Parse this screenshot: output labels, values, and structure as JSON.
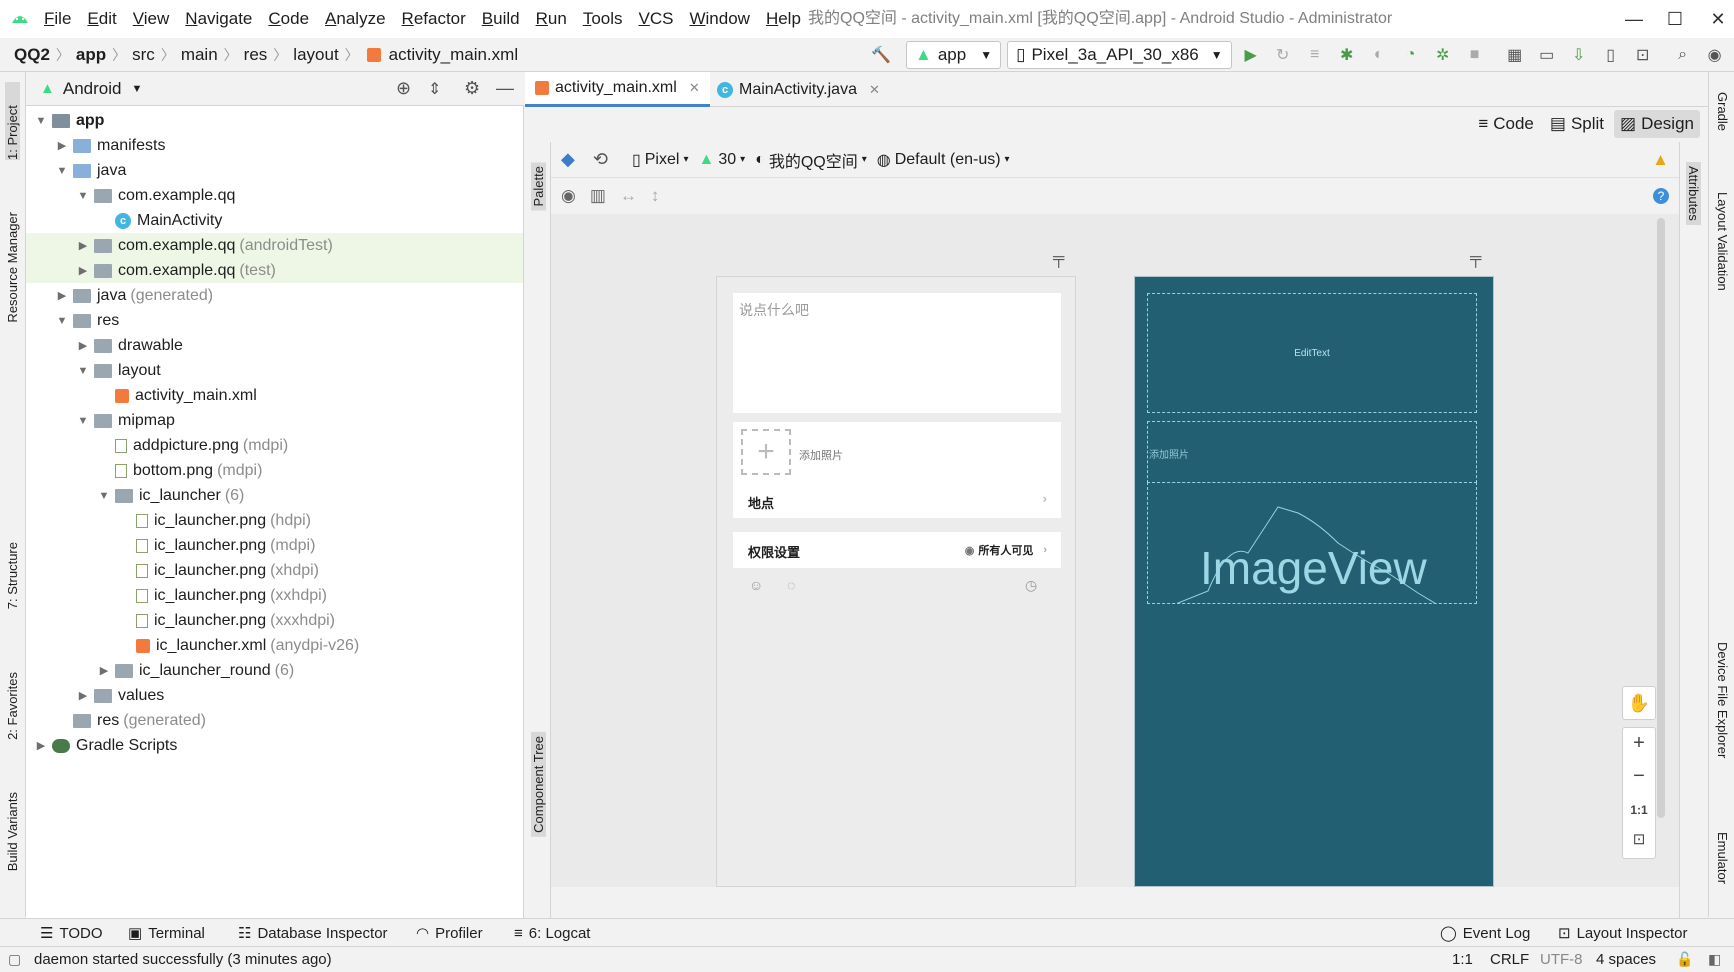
{
  "menu": [
    "File",
    "Edit",
    "View",
    "Navigate",
    "Code",
    "Analyze",
    "Refactor",
    "Build",
    "Run",
    "Tools",
    "VCS",
    "Window",
    "Help"
  ],
  "window_title": "我的QQ空间 - activity_main.xml [我的QQ空间.app] - Android Studio - Administrator",
  "breadcrumb": [
    "QQ2",
    "app",
    "src",
    "main",
    "res",
    "layout",
    "activity_main.xml"
  ],
  "run_config": "app",
  "device": "Pixel_3a_API_30_x86",
  "project_view": "Android",
  "tree": [
    {
      "label": "app",
      "extra": "",
      "depth": 0,
      "arrow": "▼",
      "icon": "module",
      "bold": true,
      "hl": false
    },
    {
      "label": "manifests",
      "extra": "",
      "depth": 1,
      "arrow": "▶",
      "icon": "folder-blue",
      "bold": false,
      "hl": false
    },
    {
      "label": "java",
      "extra": "",
      "depth": 1,
      "arrow": "▼",
      "icon": "folder-blue",
      "bold": false,
      "hl": false
    },
    {
      "label": "com.example.qq",
      "extra": "",
      "depth": 2,
      "arrow": "▼",
      "icon": "package",
      "bold": false,
      "hl": false
    },
    {
      "label": "MainActivity",
      "extra": "",
      "depth": 3,
      "arrow": "",
      "icon": "class",
      "bold": false,
      "hl": false
    },
    {
      "label": "com.example.qq",
      "extra": "(androidTest)",
      "depth": 2,
      "arrow": "▶",
      "icon": "package",
      "bold": false,
      "hl": true
    },
    {
      "label": "com.example.qq",
      "extra": "(test)",
      "depth": 2,
      "arrow": "▶",
      "icon": "package",
      "bold": false,
      "hl": true
    },
    {
      "label": "java",
      "extra": "(generated)",
      "depth": 1,
      "arrow": "▶",
      "icon": "folder-gen",
      "bold": false,
      "hl": false
    },
    {
      "label": "res",
      "extra": "",
      "depth": 1,
      "arrow": "▼",
      "icon": "folder-res",
      "bold": false,
      "hl": false
    },
    {
      "label": "drawable",
      "extra": "",
      "depth": 2,
      "arrow": "▶",
      "icon": "package",
      "bold": false,
      "hl": false
    },
    {
      "label": "layout",
      "extra": "",
      "depth": 2,
      "arrow": "▼",
      "icon": "package",
      "bold": false,
      "hl": false
    },
    {
      "label": "activity_main.xml",
      "extra": "",
      "depth": 3,
      "arrow": "",
      "icon": "xml",
      "bold": false,
      "hl": false
    },
    {
      "label": "mipmap",
      "extra": "",
      "depth": 2,
      "arrow": "▼",
      "icon": "package",
      "bold": false,
      "hl": false
    },
    {
      "label": "addpicture.png",
      "extra": "(mdpi)",
      "depth": 3,
      "arrow": "",
      "icon": "png",
      "bold": false,
      "hl": false
    },
    {
      "label": "bottom.png",
      "extra": "(mdpi)",
      "depth": 3,
      "arrow": "",
      "icon": "png",
      "bold": false,
      "hl": false
    },
    {
      "label": "ic_launcher",
      "extra": "(6)",
      "depth": 3,
      "arrow": "▼",
      "icon": "package",
      "bold": false,
      "hl": false
    },
    {
      "label": "ic_launcher.png",
      "extra": "(hdpi)",
      "depth": 4,
      "arrow": "",
      "icon": "png",
      "bold": false,
      "hl": false
    },
    {
      "label": "ic_launcher.png",
      "extra": "(mdpi)",
      "depth": 4,
      "arrow": "",
      "icon": "png",
      "bold": false,
      "hl": false
    },
    {
      "label": "ic_launcher.png",
      "extra": "(xhdpi)",
      "depth": 4,
      "arrow": "",
      "icon": "png",
      "bold": false,
      "hl": false
    },
    {
      "label": "ic_launcher.png",
      "extra": "(xxhdpi)",
      "depth": 4,
      "arrow": "",
      "icon": "png",
      "bold": false,
      "hl": false
    },
    {
      "label": "ic_launcher.png",
      "extra": "(xxxhdpi)",
      "depth": 4,
      "arrow": "",
      "icon": "png",
      "bold": false,
      "hl": false
    },
    {
      "label": "ic_launcher.xml",
      "extra": "(anydpi-v26)",
      "depth": 4,
      "arrow": "",
      "icon": "xml",
      "bold": false,
      "hl": false
    },
    {
      "label": "ic_launcher_round",
      "extra": "(6)",
      "depth": 3,
      "arrow": "▶",
      "icon": "package",
      "bold": false,
      "hl": false
    },
    {
      "label": "values",
      "extra": "",
      "depth": 2,
      "arrow": "▶",
      "icon": "package",
      "bold": false,
      "hl": false
    },
    {
      "label": "res",
      "extra": "(generated)",
      "depth": 1,
      "arrow": "",
      "icon": "folder-res",
      "bold": false,
      "hl": false
    },
    {
      "label": "Gradle Scripts",
      "extra": "",
      "depth": 0,
      "arrow": "▶",
      "icon": "gradle",
      "bold": false,
      "hl": false
    }
  ],
  "tabs": [
    {
      "label": "activity_main.xml",
      "active": true
    },
    {
      "label": "MainActivity.java",
      "active": false
    }
  ],
  "modes": {
    "code": "Code",
    "split": "Split",
    "design": "Design"
  },
  "design_toolbar": {
    "device": "Pixel",
    "api": "30",
    "theme": "我的QQ空间",
    "locale": "Default (en-us)"
  },
  "left_strip": {
    "project": "1: Project",
    "resource_manager": "Resource Manager",
    "structure": "7: Structure",
    "favorites": "2: Favorites",
    "build_variants": "Build Variants"
  },
  "right_strip": {
    "gradle": "Gradle",
    "layout_validation": "Layout Validation",
    "device_file_explorer": "Device File Explorer",
    "emulator": "Emulator"
  },
  "palette_label": "Palette",
  "component_tree_label": "Component Tree",
  "attributes_label": "Attributes",
  "phone": {
    "hint": "说点什么吧",
    "add_photo": "添加照片",
    "location": "地点",
    "permission": "权限设置",
    "visibility": "所有人可见"
  },
  "blueprint": {
    "edittext": "EditText",
    "add_photo": "添加照片",
    "imageview": "ImageView"
  },
  "zoom": {
    "one_to_one": "1:1"
  },
  "bottom_tools": [
    "TODO",
    "Terminal",
    "Database Inspector",
    "Profiler",
    "6: Logcat"
  ],
  "bottom_right_tools": [
    "Event Log",
    "Layout Inspector"
  ],
  "status": {
    "message": "daemon started successfully (3 minutes ago)",
    "position": "1:1",
    "line_sep": "CRLF",
    "encoding": "UTF-8",
    "indent": "4 spaces"
  },
  "colors": {
    "accent": "#4083c9",
    "blueprint": "#235f72",
    "android_green": "#3ddc84",
    "tree_highlight": "#eef7e6"
  }
}
